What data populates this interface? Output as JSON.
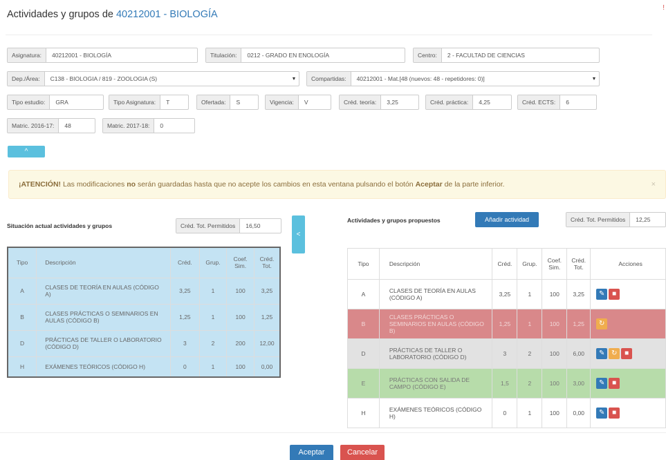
{
  "header": {
    "title_prefix": "Actividades y grupos de",
    "title_code": "40212001 - BIOLOGÍA",
    "corner_mark": "!"
  },
  "form": {
    "asignatura": {
      "label": "Asignatura:",
      "value": "40212001 - BIOLOGÍA"
    },
    "titulacion": {
      "label": "Titulación:",
      "value": "0212 - GRADO EN ENOLOGÍA"
    },
    "centro": {
      "label": "Centro:",
      "value": "2 - FACULTAD DE CIENCIAS"
    },
    "dep_area": {
      "label": "Dep./Área:",
      "value": "C138 - BIOLOGIA / 819 - ZOOLOGIA (S)"
    },
    "compartidas": {
      "label": "Compartidas:",
      "value": "40212001 - Mat.[48 (nuevos: 48 - repetidores: 0)]"
    },
    "tipo_estudio": {
      "label": "Tipo estudio:",
      "value": "GRA"
    },
    "tipo_asignatura": {
      "label": "Tipo Asignatura:",
      "value": "T"
    },
    "ofertada": {
      "label": "Ofertada:",
      "value": "S"
    },
    "vigencia": {
      "label": "Vigencia:",
      "value": "V"
    },
    "cred_teoria": {
      "label": "Créd. teoría:",
      "value": "3,25"
    },
    "cred_practica": {
      "label": "Créd. práctica:",
      "value": "4,25"
    },
    "cred_ects": {
      "label": "Créd. ECTS:",
      "value": "6"
    },
    "matric_2016": {
      "label": "Matric. 2016-17:",
      "value": "48"
    },
    "matric_2017": {
      "label": "Matric. 2017-18:",
      "value": "0"
    },
    "caret": "▼"
  },
  "collapse_icon": "^",
  "alert": {
    "strong1": "¡ATENCIÓN!",
    "text1": "Las modificaciones",
    "strong2": "no",
    "text2": "serán guardadas hasta que no acepte los cambios en esta ventana pulsando el botón",
    "strong3": "Aceptar",
    "text3": "de la parte inferior.",
    "close": "×"
  },
  "left_panel": {
    "title": "Situación actual actividades y grupos",
    "cred_label": "Créd. Tot. Permitidos",
    "cred_value": "16,50",
    "headers": [
      "Tipo",
      "Descripción",
      "Créd.",
      "Grup.",
      "Coef. Sim.",
      "Créd. Tot."
    ],
    "rows": [
      {
        "tipo": "A",
        "desc": "CLASES DE TEORÍA EN AULAS (CÓDIGO A)",
        "cred": "3,25",
        "grup": "1",
        "coef": "100",
        "tot": "3,25"
      },
      {
        "tipo": "B",
        "desc": "CLASES PRÁCTICAS O SEMINARIOS EN AULAS (CÓDIGO B)",
        "cred": "1,25",
        "grup": "1",
        "coef": "100",
        "tot": "1,25"
      },
      {
        "tipo": "D",
        "desc": "PRÁCTICAS DE TALLER O LABORATORIO (CÓDIGO D)",
        "cred": "3",
        "grup": "2",
        "coef": "200",
        "tot": "12,00"
      },
      {
        "tipo": "H",
        "desc": "EXÁMENES TEÓRICOS (CÓDIGO H)",
        "cred": "0",
        "grup": "1",
        "coef": "100",
        "tot": "0,00"
      }
    ]
  },
  "side_toggle_icon": "<",
  "right_panel": {
    "title": "Actividades y grupos propuestos",
    "add_button": "Añadir actividad",
    "cred_label": "Créd. Tot. Permitidos",
    "cred_value": "12,25",
    "headers": [
      "Tipo",
      "Descripción",
      "Créd.",
      "Grup.",
      "Coef. Sim.",
      "Créd. Tot.",
      "Acciones"
    ],
    "rows": [
      {
        "tipo": "A",
        "desc": "CLASES DE TEORÍA EN AULAS (CÓDIGO A)",
        "cred": "3,25",
        "grup": "1",
        "coef": "100",
        "tot": "3,25",
        "state": "normal"
      },
      {
        "tipo": "B",
        "desc": "CLASES PRÁCTICAS O SEMINARIOS EN AULAS (CÓDIGO B)",
        "cred": "1,25",
        "grup": "1",
        "coef": "100",
        "tot": "1,25",
        "state": "deleted"
      },
      {
        "tipo": "D",
        "desc": "PRÁCTICAS DE TALLER O LABORATORIO (CÓDIGO D)",
        "cred": "3",
        "grup": "2",
        "coef": "100",
        "tot": "6,00",
        "state": "modified"
      },
      {
        "tipo": "E",
        "desc": "PRÁCTICAS CON SALIDA DE CAMPO (CÓDIGO E)",
        "cred": "1,5",
        "grup": "2",
        "coef": "100",
        "tot": "3,00",
        "state": "added"
      },
      {
        "tipo": "H",
        "desc": "EXÁMENES TEÓRICOS (CÓDIGO H)",
        "cred": "0",
        "grup": "1",
        "coef": "100",
        "tot": "0,00",
        "state": "normal"
      }
    ],
    "icons": {
      "edit": "✎",
      "delete": "■",
      "restore": "↻"
    },
    "colors": {
      "deleted": "#d9888a",
      "modified": "#e2e2e2",
      "added": "#b7dcaa"
    }
  },
  "footer": {
    "accept": "Aceptar",
    "cancel": "Cancelar"
  }
}
